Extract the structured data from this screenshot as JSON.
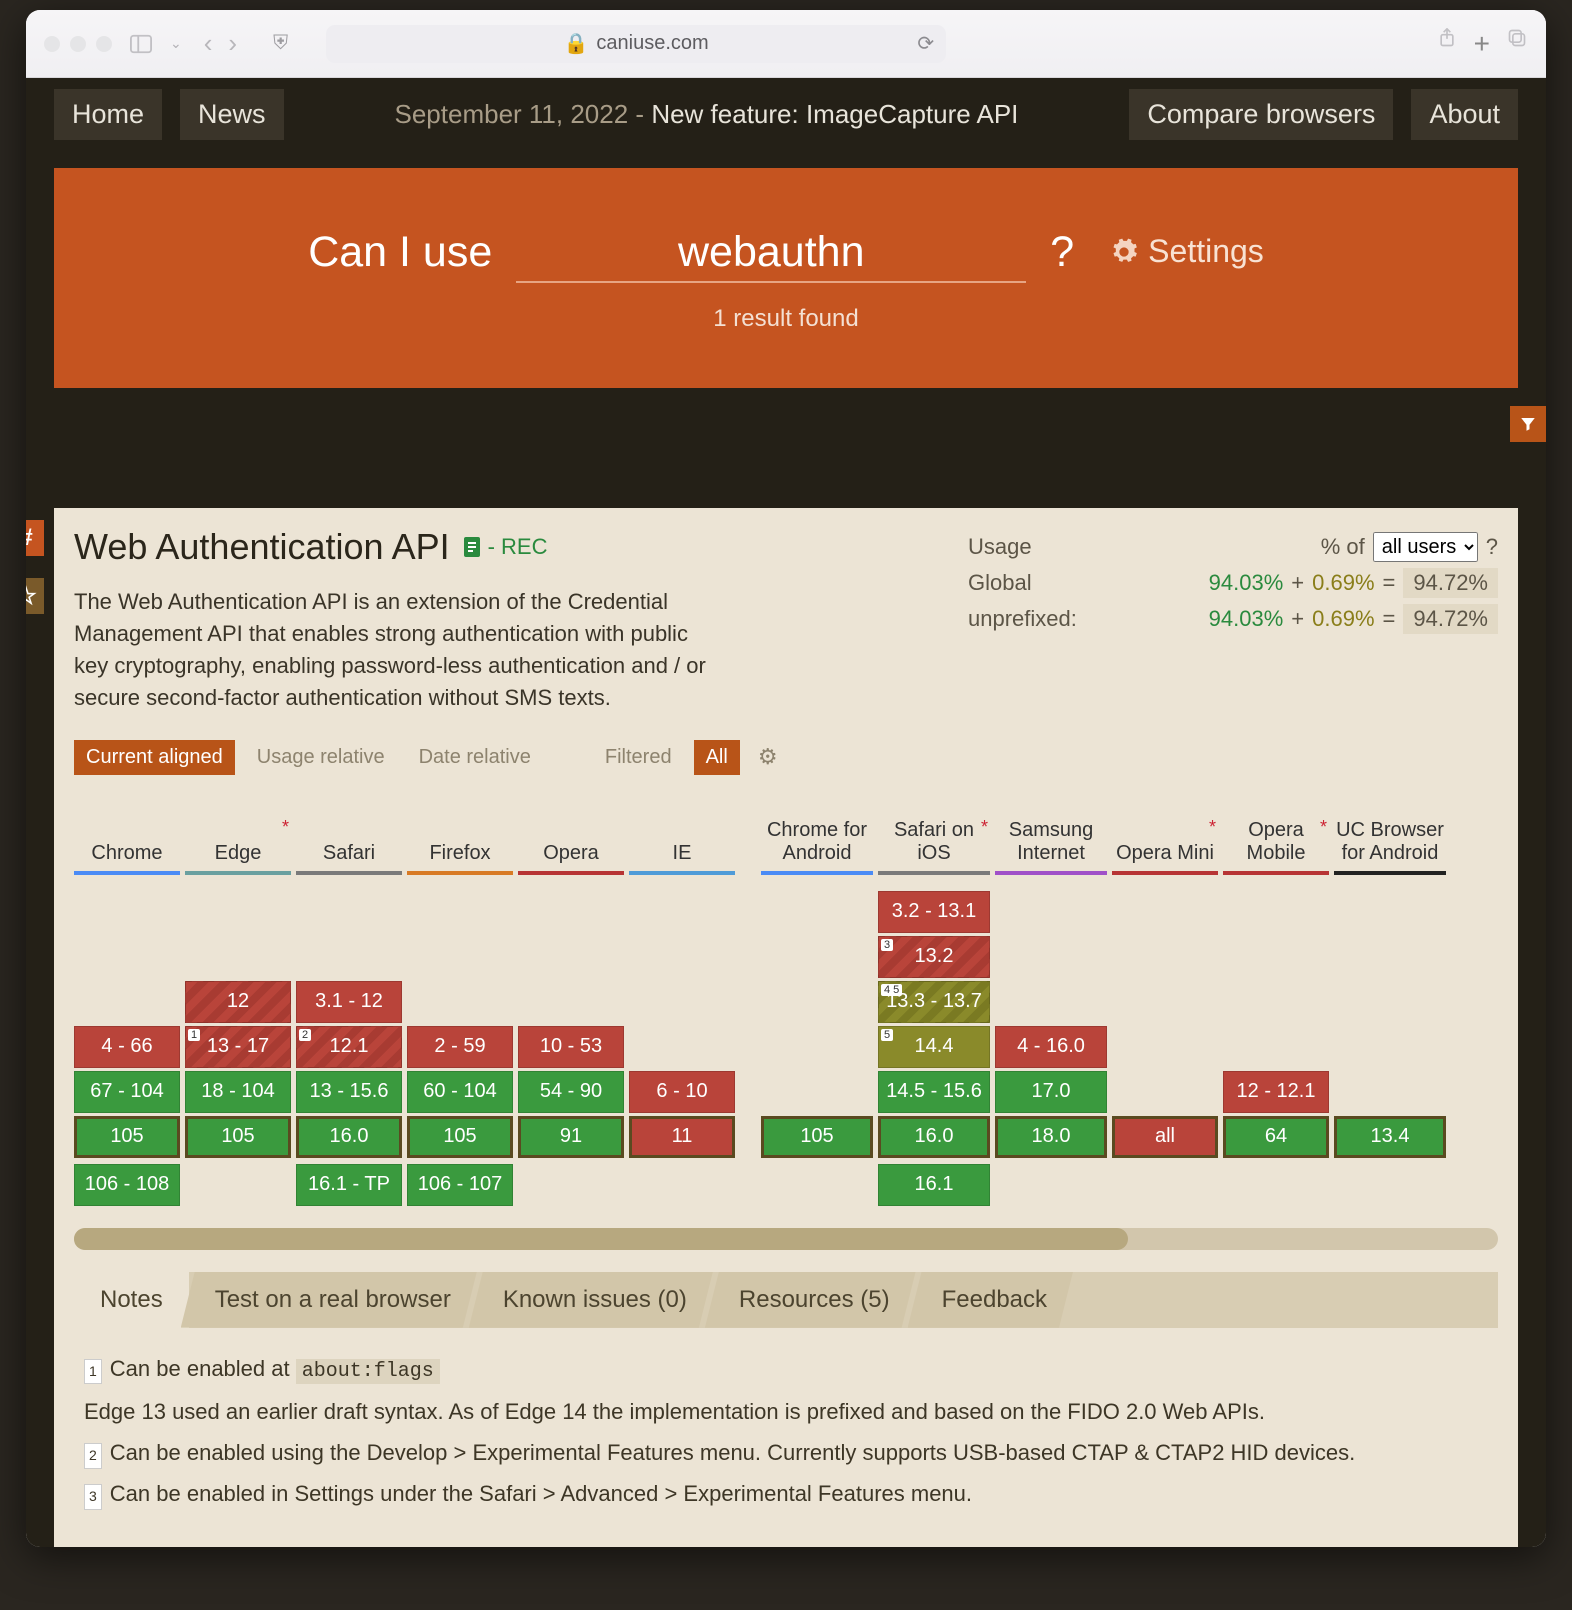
{
  "browser": {
    "url": "caniuse.com",
    "lock": "🔒"
  },
  "nav": {
    "home": "Home",
    "news": "News",
    "compare": "Compare browsers",
    "about": "About",
    "date": "September 11, 2022",
    "announcement": "New feature: ImageCapture API"
  },
  "search": {
    "label": "Can I use",
    "value": "webauthn",
    "question": "?",
    "settings": "Settings",
    "result_count": "1 result found"
  },
  "feature": {
    "title": "Web Authentication API",
    "spec_status": "- REC",
    "description": "The Web Authentication API is an extension of the Credential Management API that enables strong authentication with public key cryptography, enabling password-less authentication and / or secure second-factor authentication without SMS texts."
  },
  "usage": {
    "heading": "Usage",
    "percent_of": "% of",
    "selector_value": "all users",
    "help": "?",
    "rows": [
      {
        "label": "Global",
        "main": "94.03%",
        "plus": "+",
        "extra": "0.69%",
        "eq": "=",
        "total": "94.72%"
      },
      {
        "label": "unprefixed:",
        "main": "94.03%",
        "plus": "+",
        "extra": "0.69%",
        "eq": "=",
        "total": "94.72%"
      }
    ]
  },
  "modes": {
    "tabs": [
      "Current aligned",
      "Usage relative",
      "Date relative"
    ],
    "filter_label": "Filtered",
    "all": "All"
  },
  "browsers_desktop": [
    {
      "key": "chrome",
      "name": "Chrome",
      "star": false,
      "cells": [
        {
          "t": "4 - 66",
          "c": "red"
        },
        {
          "t": "67 - 104",
          "c": "green"
        },
        {
          "t": "105",
          "c": "green",
          "cur": true
        }
      ],
      "future": "106 - 108"
    },
    {
      "key": "edge",
      "name": "Edge",
      "star": true,
      "cells": [
        {
          "t": "12",
          "c": "red hatch"
        },
        {
          "t": "13 - 17",
          "c": "red hatch",
          "note": "1"
        },
        {
          "t": "18 - 104",
          "c": "green"
        },
        {
          "t": "105",
          "c": "green",
          "cur": true
        }
      ],
      "future": ""
    },
    {
      "key": "safari",
      "name": "Safari",
      "star": false,
      "cells": [
        {
          "t": "3.1 - 12",
          "c": "red"
        },
        {
          "t": "12.1",
          "c": "red hatch",
          "note": "2"
        },
        {
          "t": "13 - 15.6",
          "c": "green"
        },
        {
          "t": "16.0",
          "c": "green",
          "cur": true
        }
      ],
      "future": "16.1 - TP"
    },
    {
      "key": "firefox",
      "name": "Firefox",
      "star": false,
      "cells": [
        {
          "t": "2 - 59",
          "c": "red"
        },
        {
          "t": "60 - 104",
          "c": "green"
        },
        {
          "t": "105",
          "c": "green",
          "cur": true
        }
      ],
      "future": "106 - 107"
    },
    {
      "key": "opera",
      "name": "Opera",
      "star": false,
      "cells": [
        {
          "t": "10 - 53",
          "c": "red"
        },
        {
          "t": "54 - 90",
          "c": "green"
        },
        {
          "t": "91",
          "c": "green",
          "cur": true
        }
      ],
      "future": ""
    },
    {
      "key": "ie",
      "name": "IE",
      "star": false,
      "cells": [
        {
          "t": "6 - 10",
          "c": "red"
        },
        {
          "t": "11",
          "c": "red",
          "cur": true
        }
      ],
      "future": ""
    }
  ],
  "browsers_mobile": [
    {
      "key": "cfa",
      "name": "Chrome for Android",
      "star": false,
      "cells": [
        {
          "t": "105",
          "c": "green",
          "cur": true
        }
      ],
      "future": ""
    },
    {
      "key": "sios",
      "name": "Safari on iOS",
      "star": true,
      "cells": [
        {
          "t": "3.2 - 13.1",
          "c": "red"
        },
        {
          "t": "13.2",
          "c": "red hatch",
          "note": "3"
        },
        {
          "t": "13.3 - 13.7",
          "c": "olive hatch",
          "note": "4 5"
        },
        {
          "t": "14.4",
          "c": "olive",
          "note": "5"
        },
        {
          "t": "14.5 - 15.6",
          "c": "green"
        },
        {
          "t": "16.0",
          "c": "green",
          "cur": true
        }
      ],
      "future": "16.1"
    },
    {
      "key": "sams",
      "name": "Samsung Internet",
      "star": false,
      "cells": [
        {
          "t": "4 - 16.0",
          "c": "red"
        },
        {
          "t": "17.0",
          "c": "green"
        },
        {
          "t": "18.0",
          "c": "green",
          "cur": true
        }
      ],
      "future": ""
    },
    {
      "key": "omini",
      "name": "Opera Mini",
      "star": true,
      "cells": [
        {
          "t": "all",
          "c": "red",
          "cur": true
        }
      ],
      "future": ""
    },
    {
      "key": "omob",
      "name": "Opera Mobile",
      "star": true,
      "cells": [
        {
          "t": "12 - 12.1",
          "c": "red"
        },
        {
          "t": "64",
          "c": "green",
          "cur": true
        }
      ],
      "future": ""
    },
    {
      "key": "uc",
      "name": "UC Browser for Android",
      "star": false,
      "cells": [
        {
          "t": "13.4",
          "c": "green",
          "cur": true
        }
      ],
      "future": ""
    }
  ],
  "bottom_tabs": [
    "Notes",
    "Test on a real browser",
    "Known issues (0)",
    "Resources (5)",
    "Feedback"
  ],
  "notes": [
    {
      "sup": "1",
      "text": "Can be enabled at ",
      "code": "about:flags"
    },
    {
      "sup": "",
      "text": "Edge 13 used an earlier draft syntax. As of Edge 14 the implementation is prefixed and based on the FIDO 2.0 Web APIs."
    },
    {
      "sup": "2",
      "text": "Can be enabled using the Develop > Experimental Features menu. Currently supports USB-based CTAP & CTAP2 HID devices."
    },
    {
      "sup": "3",
      "text": "Can be enabled in Settings under the Safari > Advanced > Experimental Features menu."
    }
  ]
}
